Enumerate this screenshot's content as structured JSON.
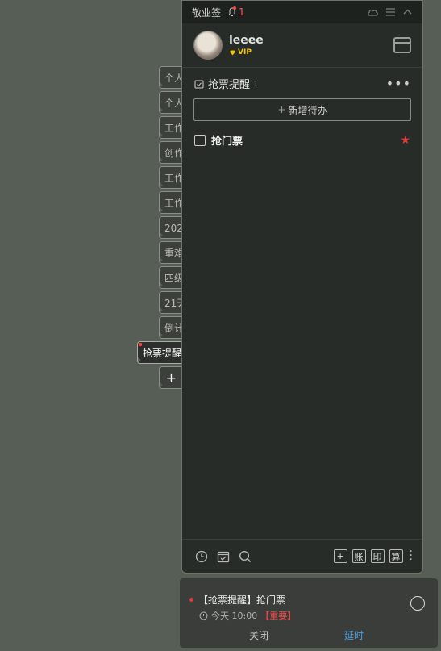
{
  "side_tabs": [
    {
      "label": "个人"
    },
    {
      "label": "个人"
    },
    {
      "label": "工作"
    },
    {
      "label": "创作"
    },
    {
      "label": "工作"
    },
    {
      "label": "工作"
    },
    {
      "label": "202"
    },
    {
      "label": "重难"
    },
    {
      "label": "四级"
    },
    {
      "label": "21天"
    },
    {
      "label": "倒计"
    }
  ],
  "active_tab": {
    "label": "抢票提醒"
  },
  "add_tab": {
    "label": "+"
  },
  "window": {
    "title": "敬业签",
    "bell_count": "1"
  },
  "user": {
    "name": "leeee",
    "badge": "VIP"
  },
  "list": {
    "title": "抢票提醒",
    "count": "1",
    "add_label": "新增待办"
  },
  "todos": [
    {
      "text": "抢门票",
      "starred": true
    }
  ],
  "bottom_buttons": [
    "账",
    "印",
    "算"
  ],
  "notification": {
    "title": "【抢票提醒】抢门票",
    "time": "今天  10:00",
    "tag": "【重要】",
    "close_label": "关闭",
    "delay_label": "延时"
  },
  "colors": {
    "accent_red": "#e53a3a",
    "link_blue": "#4aa0e6",
    "vip_gold": "#f5c400"
  }
}
